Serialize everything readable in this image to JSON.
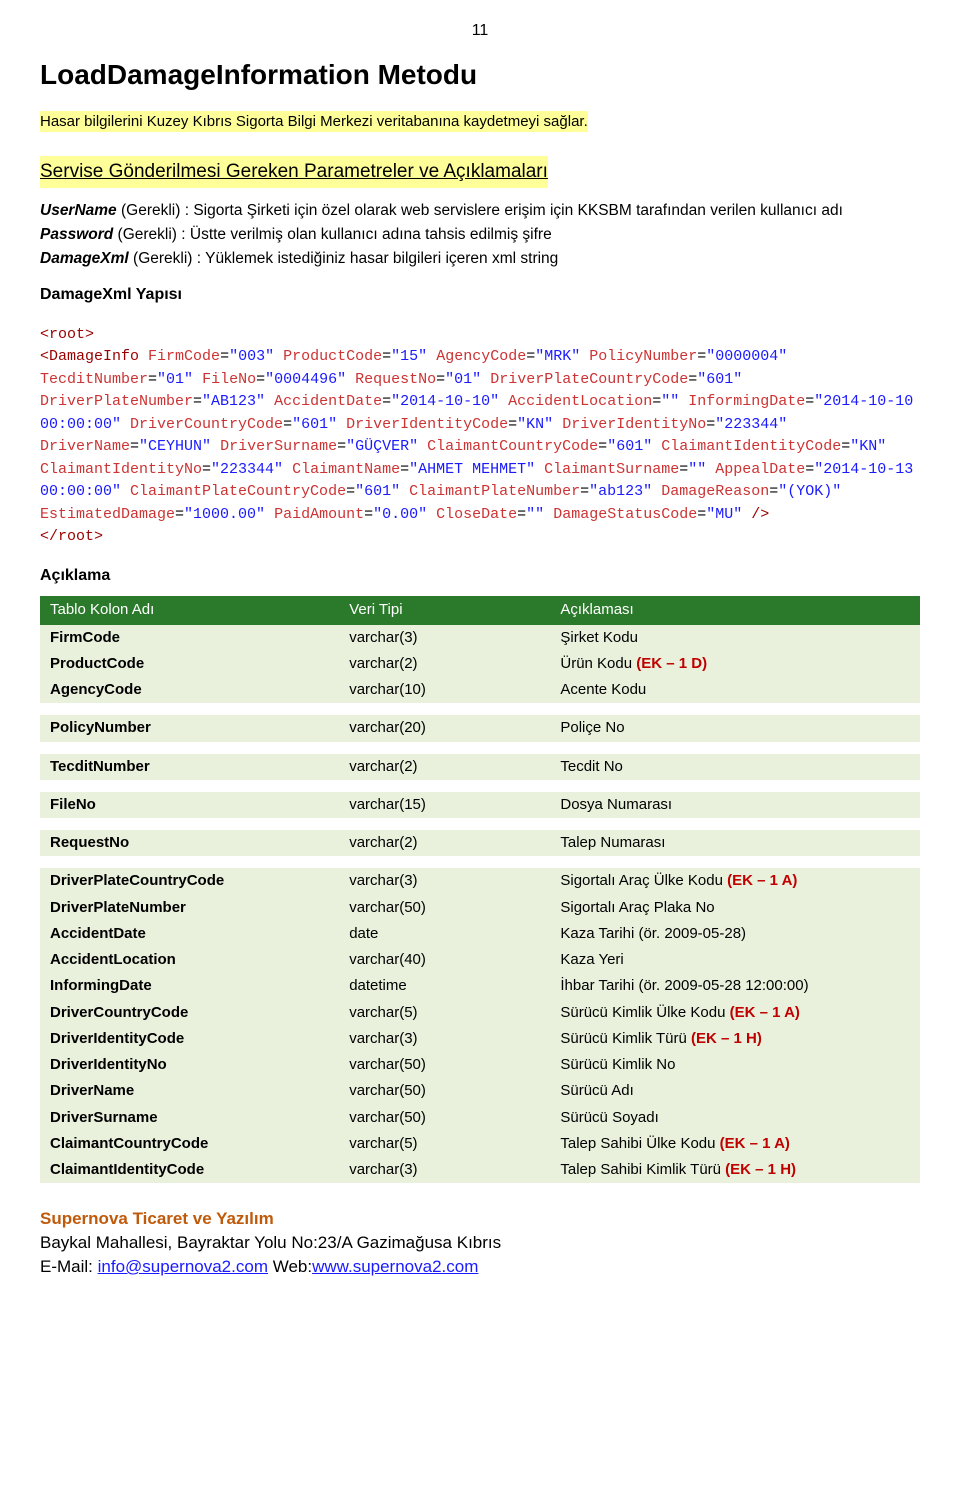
{
  "page_number": "11",
  "title": "LoadDamageInformation Metodu",
  "intro_highlight": "Hasar bilgilerini Kuzey Kıbrıs Sigorta Bilgi Merkezi veritabanına kaydetmeyi sağlar.",
  "section_heading": "Servise Gönderilmesi Gereken Parametreler ve Açıklamaları",
  "params": {
    "p1_bold": "UserName",
    "p1_rest": " (Gerekli) : Sigorta Şirketi için özel olarak web servislere erişim için KKSBM tarafından verilen kullanıcı adı",
    "p2_bold": "Password",
    "p2_rest": " (Gerekli) : Üstte verilmiş olan kullanıcı adına tahsis edilmiş şifre",
    "p3_bold": "DamageXml",
    "p3_rest": " (Gerekli) : Yüklemek istediğiniz hasar bilgileri içeren xml string"
  },
  "yapisi_label": "DamageXml Yapısı",
  "xml": {
    "root_open": "<root>",
    "tag_open": "<DamageInfo",
    "attrs": [
      {
        "n": "FirmCode",
        "v": "003"
      },
      {
        "n": "ProductCode",
        "v": "15"
      },
      {
        "n": "AgencyCode",
        "v": "MRK"
      },
      {
        "n": "PolicyNumber",
        "v": "0000004"
      },
      {
        "n": "TecditNumber",
        "v": "01"
      },
      {
        "n": "FileNo",
        "v": "0004496"
      },
      {
        "n": "RequestNo",
        "v": "01"
      },
      {
        "n": "DriverPlateCountryCode",
        "v": "601"
      },
      {
        "n": "DriverPlateNumber",
        "v": "AB123"
      },
      {
        "n": "AccidentDate",
        "v": "2014-10-10"
      },
      {
        "n": "AccidentLocation",
        "v": ""
      },
      {
        "n": "InformingDate",
        "v": "2014-10-10 00:00:00"
      },
      {
        "n": "DriverCountryCode",
        "v": "601"
      },
      {
        "n": "DriverIdentityCode",
        "v": "KN"
      },
      {
        "n": "DriverIdentityNo",
        "v": "223344"
      },
      {
        "n": "DriverName",
        "v": "CEYHUN"
      },
      {
        "n": "DriverSurname",
        "v": "GÜÇVER"
      },
      {
        "n": "ClaimantCountryCode",
        "v": "601"
      },
      {
        "n": "ClaimantIdentityCode",
        "v": "KN"
      },
      {
        "n": "ClaimantIdentityNo",
        "v": "223344"
      },
      {
        "n": "ClaimantName",
        "v": "AHMET MEHMET"
      },
      {
        "n": "ClaimantSurname",
        "v": ""
      },
      {
        "n": "AppealDate",
        "v": "2014-10-13 00:00:00"
      },
      {
        "n": "ClaimantPlateCountryCode",
        "v": "601"
      },
      {
        "n": "ClaimantPlateNumber",
        "v": "ab123"
      },
      {
        "n": "DamageReason",
        "v": "(YOK)"
      },
      {
        "n": "EstimatedDamage",
        "v": "1000.00"
      },
      {
        "n": "PaidAmount",
        "v": "0.00"
      },
      {
        "n": "CloseDate",
        "v": ""
      },
      {
        "n": "DamageStatusCode",
        "v": "MU"
      }
    ],
    "tag_close": " />",
    "root_close": "</root>"
  },
  "aciklama_label": "Açıklama",
  "table": {
    "headers": [
      "Tablo Kolon Adı",
      "Veri Tipi",
      "Açıklaması"
    ],
    "groups": [
      [
        {
          "c0": "FirmCode",
          "c1": "varchar(3)",
          "c2": "Şirket Kodu",
          "ek": ""
        },
        {
          "c0": "ProductCode",
          "c1": "varchar(2)",
          "c2": "Ürün Kodu ",
          "ek": "(EK – 1 D)"
        },
        {
          "c0": "AgencyCode",
          "c1": "varchar(10)",
          "c2": "Acente Kodu",
          "ek": ""
        }
      ],
      [
        {
          "c0": "PolicyNumber",
          "c1": "varchar(20)",
          "c2": "Poliçe No",
          "ek": ""
        }
      ],
      [
        {
          "c0": "TecditNumber",
          "c1": "varchar(2)",
          "c2": "Tecdit No",
          "ek": ""
        }
      ],
      [
        {
          "c0": "FileNo",
          "c1": "varchar(15)",
          "c2": "Dosya Numarası",
          "ek": ""
        }
      ],
      [
        {
          "c0": "RequestNo",
          "c1": "varchar(2)",
          "c2": "Talep Numarası",
          "ek": ""
        }
      ],
      [
        {
          "c0": "DriverPlateCountryCode",
          "c1": "varchar(3)",
          "c2": "Sigortalı Araç Ülke Kodu ",
          "ek": "(EK – 1 A)"
        },
        {
          "c0": "DriverPlateNumber",
          "c1": "varchar(50)",
          "c2": "Sigortalı Araç Plaka No",
          "ek": ""
        },
        {
          "c0": "AccidentDate",
          "c1": "date",
          "c2": "Kaza Tarihi (ör. 2009-05-28)",
          "ek": ""
        },
        {
          "c0": "AccidentLocation",
          "c1": "varchar(40)",
          "c2": "Kaza Yeri",
          "ek": ""
        },
        {
          "c0": "InformingDate",
          "c1": "datetime",
          "c2": "İhbar Tarihi (ör. 2009-05-28 12:00:00)",
          "ek": ""
        },
        {
          "c0": "DriverCountryCode",
          "c1": "varchar(5)",
          "c2": "Sürücü Kimlik Ülke Kodu ",
          "ek": "(EK – 1 A)"
        },
        {
          "c0": "DriverIdentityCode",
          "c1": "varchar(3)",
          "c2": "Sürücü Kimlik Türü ",
          "ek": "(EK – 1 H)"
        },
        {
          "c0": "DriverIdentityNo",
          "c1": "varchar(50)",
          "c2": "Sürücü Kimlik No",
          "ek": ""
        },
        {
          "c0": "DriverName",
          "c1": "varchar(50)",
          "c2": "Sürücü Adı",
          "ek": ""
        },
        {
          "c0": "DriverSurname",
          "c1": "varchar(50)",
          "c2": "Sürücü Soyadı",
          "ek": ""
        },
        {
          "c0": "ClaimantCountryCode",
          "c1": "varchar(5)",
          "c2": "Talep Sahibi Ülke Kodu  ",
          "ek": "(EK – 1 A)"
        },
        {
          "c0": "ClaimantIdentityCode",
          "c1": "varchar(3)",
          "c2": "Talep Sahibi Kimlik Türü ",
          "ek": "(EK – 1 H)"
        }
      ]
    ]
  },
  "footer": {
    "company": "Supernova Ticaret ve Yazılım",
    "addr": "Baykal Mahallesi, Bayraktar Yolu No:23/A Gazimağusa Kıbrıs",
    "email_label": "E-Mail: ",
    "email": "info@supernova2.com",
    "web_label": " Web:",
    "web": "www.supernova2.com"
  }
}
